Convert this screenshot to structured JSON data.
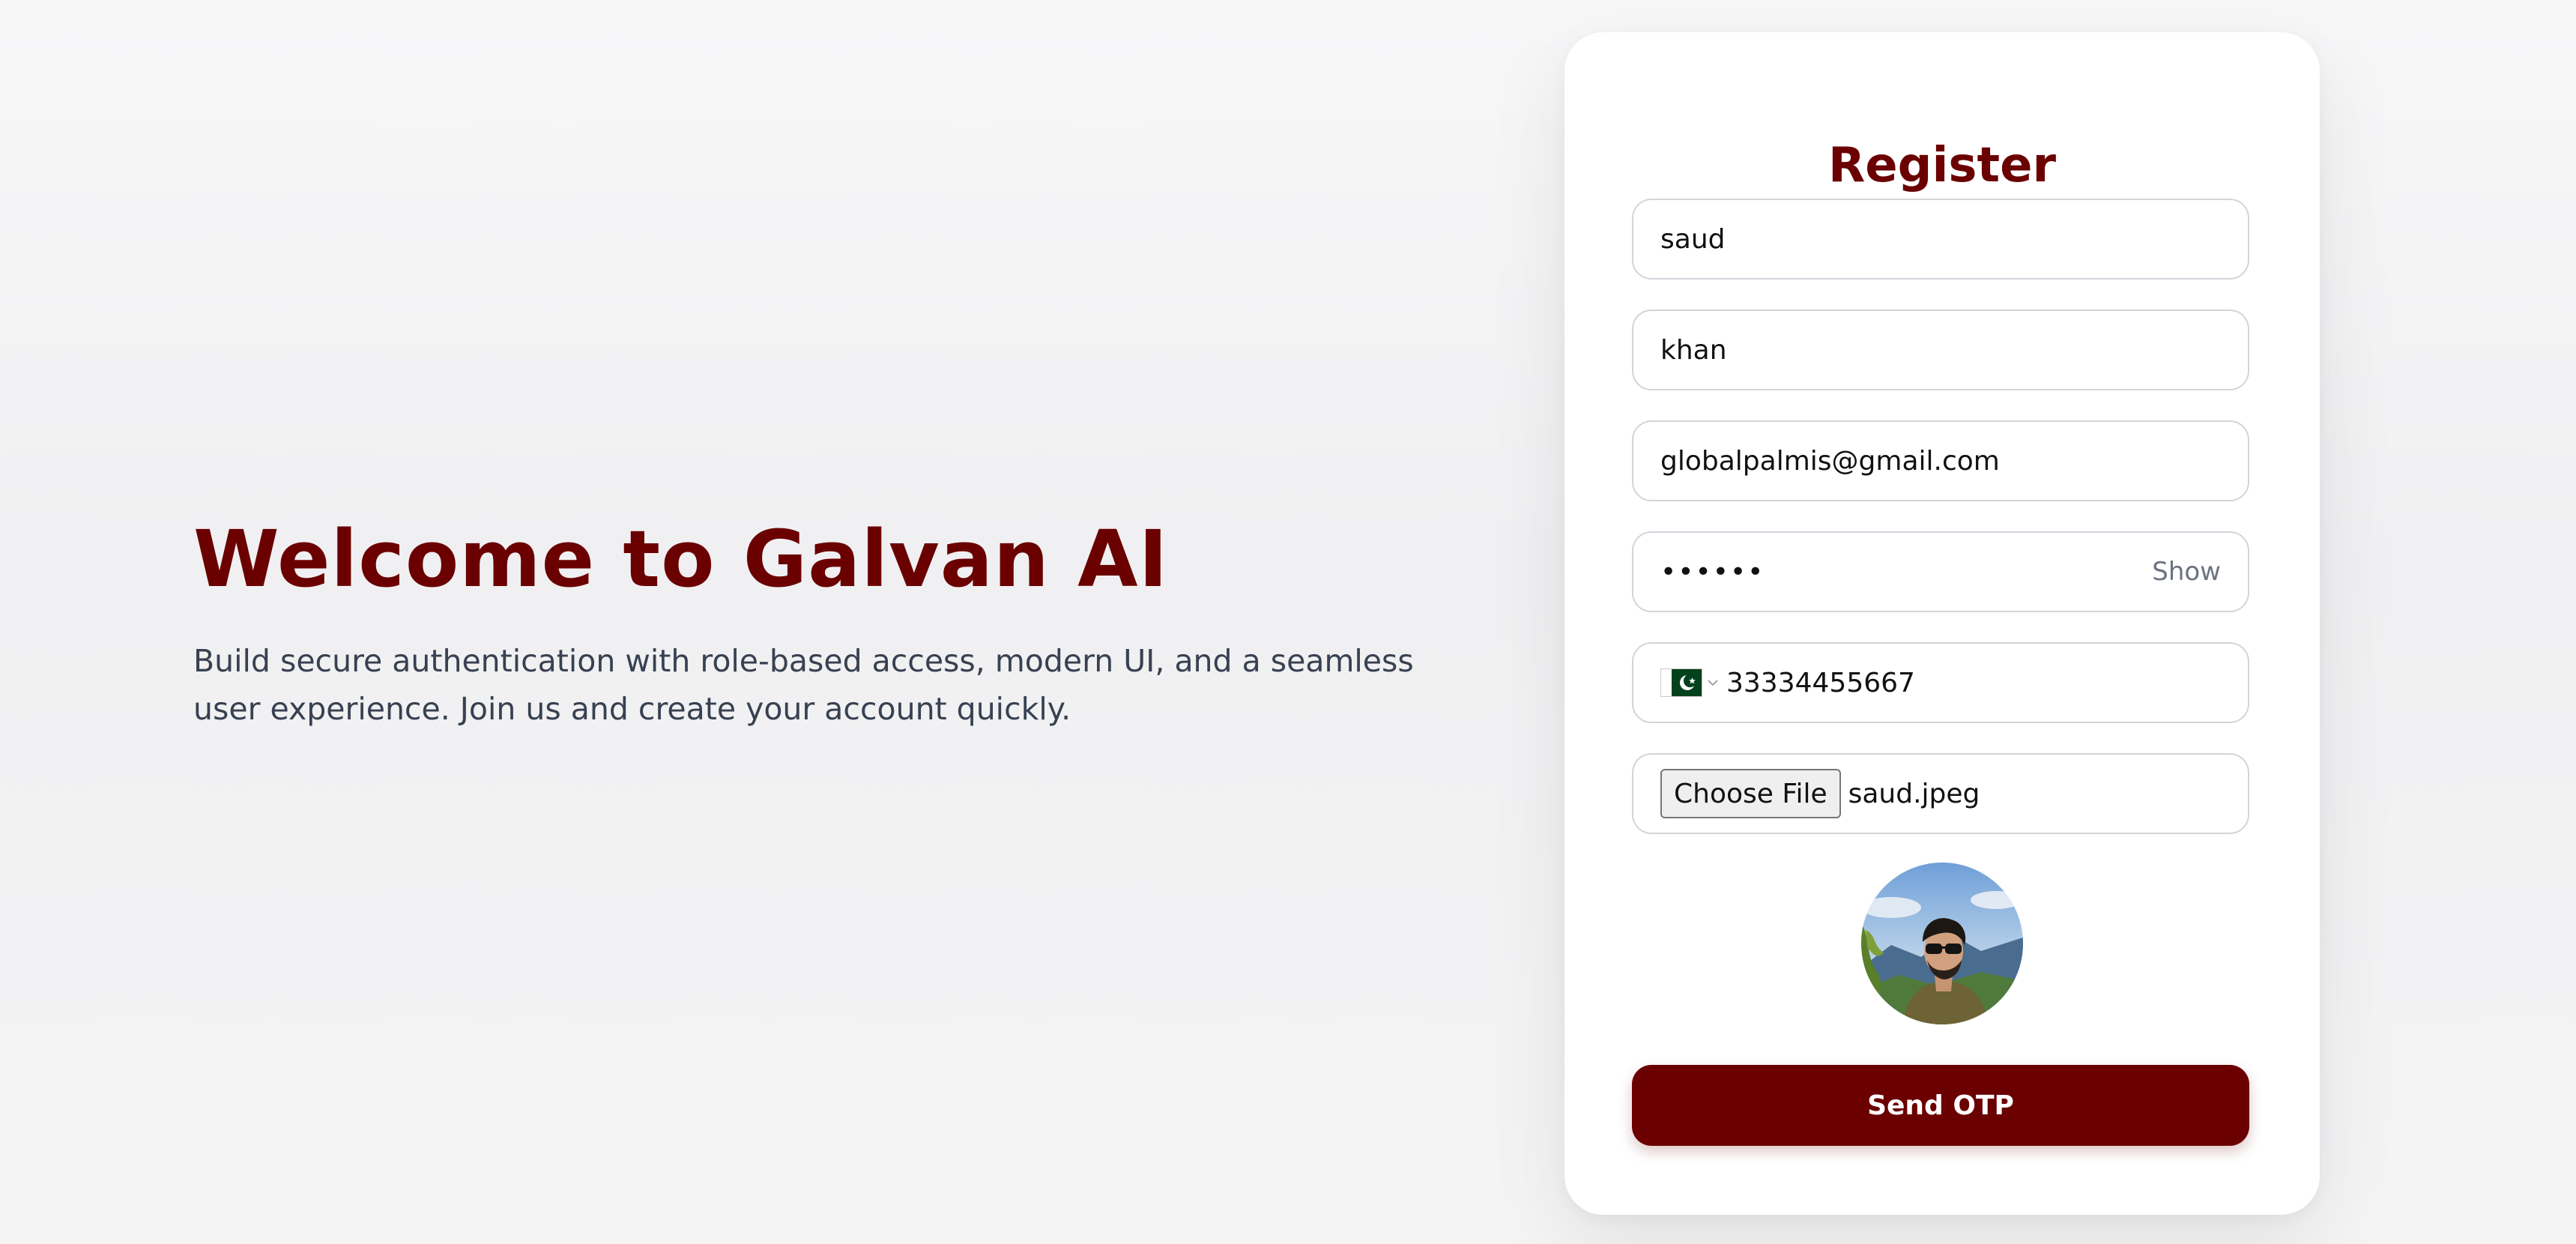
{
  "hero": {
    "title": "Welcome to Galvan AI",
    "subtitle": "Build secure authentication with role-based access, modern UI, and a seamless user experience. Join us and create your account quickly."
  },
  "register": {
    "title": "Register",
    "first_name": "saud",
    "last_name": "khan",
    "email": "globalpalmis@gmail.com",
    "password": "••••••",
    "show_label": "Show",
    "phone": {
      "country_flag": "pakistan-flag-icon",
      "number": "33334455667"
    },
    "file": {
      "button_label": "Choose File",
      "file_name": "saud.jpeg"
    },
    "avatar": "profile-photo",
    "submit_label": "Send OTP"
  },
  "colors": {
    "brand": "#6b0000",
    "background": "#f4f4f5",
    "card": "#ffffff",
    "field_border": "#d1d5db",
    "subtitle_text": "#374151",
    "muted_text": "#6b7280"
  }
}
